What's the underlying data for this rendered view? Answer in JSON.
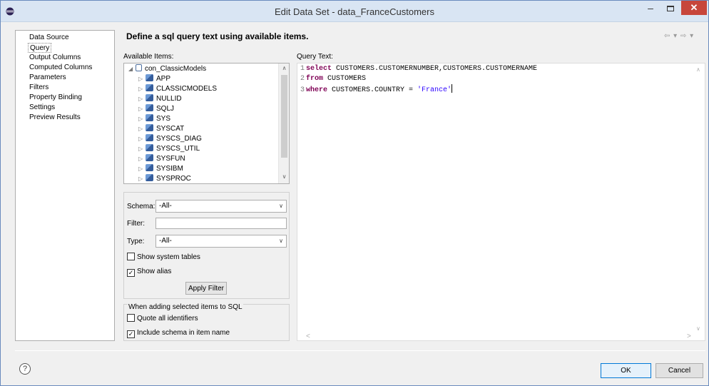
{
  "window": {
    "title": "Edit Data Set - data_FranceCustomers",
    "close_glyph": "✕",
    "min_glyph": "–"
  },
  "nav": {
    "items": [
      {
        "label": "Data Source",
        "selected": false
      },
      {
        "label": "Query",
        "selected": true
      },
      {
        "label": "Output Columns",
        "selected": false
      },
      {
        "label": "Computed Columns",
        "selected": false
      },
      {
        "label": "Parameters",
        "selected": false
      },
      {
        "label": "Filters",
        "selected": false
      },
      {
        "label": "Property Binding",
        "selected": false
      },
      {
        "label": "Settings",
        "selected": false
      },
      {
        "label": "Preview Results",
        "selected": false
      }
    ],
    "back_forward_glyph": "⇦ ▾ ⇨ ▾"
  },
  "page": {
    "title": "Define a sql query text using available items."
  },
  "available": {
    "label": "Available Items:",
    "root": "con_ClassicModels",
    "schemas": [
      "APP",
      "CLASSICMODELS",
      "NULLID",
      "SQLJ",
      "SYS",
      "SYSCAT",
      "SYSCS_DIAG",
      "SYSCS_UTIL",
      "SYSFUN",
      "SYSIBM",
      "SYSPROC"
    ]
  },
  "filters": {
    "schema_label": "Schema:",
    "schema_value": "-All-",
    "filter_label": "Filter:",
    "filter_value": "",
    "type_label": "Type:",
    "type_value": "-All-",
    "show_system_tables_label": "Show system tables",
    "show_system_tables_checked": false,
    "show_alias_label": "Show alias",
    "show_alias_checked": true,
    "apply_label": "Apply Filter"
  },
  "adding": {
    "group_title": "When adding selected items to SQL",
    "quote_label": "Quote all identifiers",
    "quote_checked": false,
    "include_schema_label": "Include schema in item name",
    "include_schema_checked": true
  },
  "query": {
    "label": "Query Text:",
    "lines": [
      {
        "num": "1",
        "keyword": "select",
        "text": " CUSTOMERS.CUSTOMERNUMBER,CUSTOMERS.CUSTOMERNAME",
        "string": ""
      },
      {
        "num": "2",
        "keyword": "from",
        "text": " CUSTOMERS",
        "string": ""
      },
      {
        "num": "3",
        "keyword": "where",
        "text": " CUSTOMERS.COUNTRY = ",
        "string": "'France'"
      }
    ]
  },
  "footer": {
    "help_glyph": "?",
    "ok_label": "OK",
    "cancel_label": "Cancel"
  },
  "colors": {
    "keyword": "#7f0055",
    "string": "#2a00ff",
    "close_button": "#c7463b",
    "titlebar": "#d9e5f3"
  }
}
